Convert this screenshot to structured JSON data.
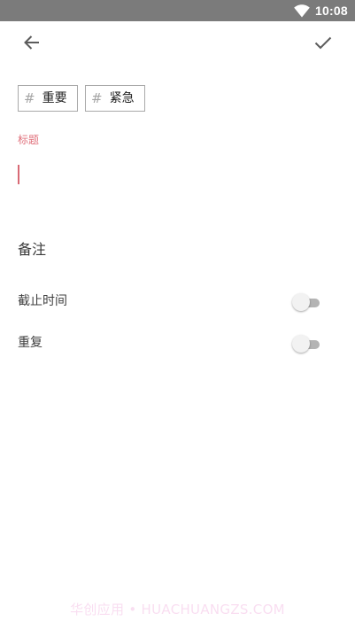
{
  "status_bar": {
    "time": "10:08",
    "icons": [
      "wifi-icon"
    ],
    "background": "#7b7b7b"
  },
  "toolbar": {
    "back_icon": "arrow-left-icon",
    "confirm_icon": "checkmark-icon"
  },
  "tags": [
    {
      "hash": "#",
      "label": "重要"
    },
    {
      "hash": "#",
      "label": "紧急"
    }
  ],
  "title_field": {
    "label": "标题",
    "value": "",
    "accent_color": "#e0707b"
  },
  "note_field": {
    "placeholder": "备注",
    "value": ""
  },
  "settings": [
    {
      "label": "截止时间",
      "enabled": false
    },
    {
      "label": "重复",
      "enabled": false
    }
  ],
  "watermark": "华创应用 • HUACHUANGZS.COM"
}
